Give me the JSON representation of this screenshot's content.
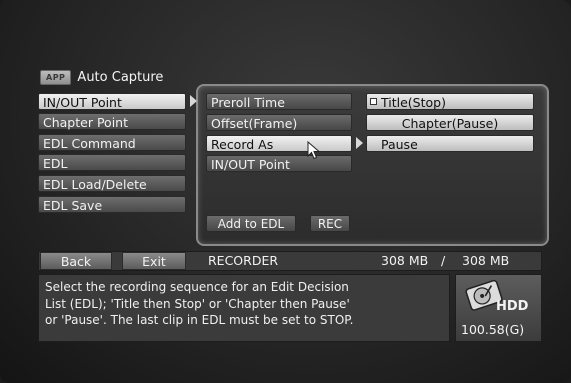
{
  "header": {
    "app_tag": "APP",
    "title": "Auto Capture"
  },
  "menu": {
    "items": [
      {
        "label": "IN/OUT Point"
      },
      {
        "label": "Chapter Point"
      },
      {
        "label": "EDL Command"
      },
      {
        "label": "EDL"
      },
      {
        "label": "EDL Load/Delete"
      },
      {
        "label": "EDL Save"
      }
    ]
  },
  "submenu": {
    "items": [
      {
        "label": "Preroll Time"
      },
      {
        "label": "Offset(Frame)"
      },
      {
        "label": "Record As"
      },
      {
        "label": "IN/OUT Point"
      }
    ]
  },
  "options": {
    "items": [
      {
        "label": "Title(Stop)"
      },
      {
        "label": "Chapter(Pause)"
      },
      {
        "label": "Pause"
      }
    ]
  },
  "actions": {
    "add_to_edl": "Add to EDL",
    "rec": "REC"
  },
  "status_bar": {
    "back": "Back",
    "exit": "Exit",
    "mode": "RECORDER",
    "used": "308 MB",
    "separator": "/",
    "total": "308 MB"
  },
  "info": {
    "line1": "Select the recording sequence for an Edit Decision",
    "line2": "List (EDL); 'Title then Stop' or 'Chapter then Pause'",
    "line3": "or 'Pause'. The last clip in EDL must be set to STOP."
  },
  "hdd": {
    "label": "HDD",
    "free_space": "100.58(G)",
    "icon": "hard-drive-icon"
  }
}
